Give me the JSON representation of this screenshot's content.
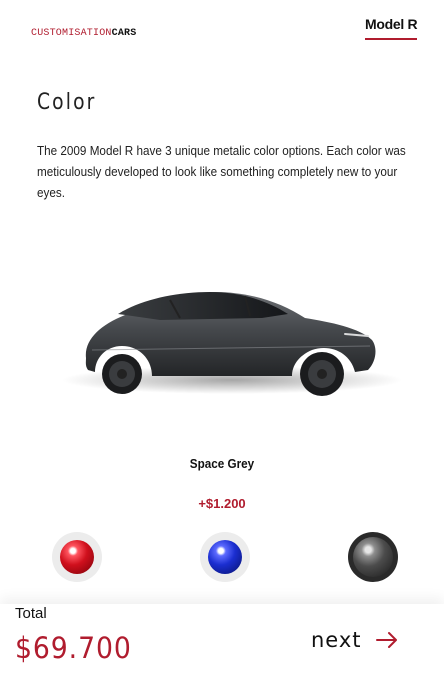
{
  "header": {
    "brand_part1": "CUSTOMISATION",
    "brand_part2": "CARS",
    "model_tab": "Model R"
  },
  "section": {
    "title": "Color",
    "description": "The 2009 Model R have 3 unique metalic color options. Each color was meticulously developed to look like something completely new to your eyes."
  },
  "selected_color": {
    "name": "Space Grey",
    "price": "+$1.200"
  },
  "swatches": [
    {
      "icon": "red-swatch-icon",
      "color": "#d0101d"
    },
    {
      "icon": "blue-swatch-icon",
      "color": "#1b2ed0"
    },
    {
      "icon": "grey-swatch-icon",
      "color": "#4c4c4c",
      "selected": true
    }
  ],
  "footer": {
    "total_label": "Total",
    "total_value": "$69.700",
    "next_label": "next",
    "next_icon": "arrow-right-icon"
  },
  "colors": {
    "accent": "#b01c2e",
    "text": "#111111"
  }
}
